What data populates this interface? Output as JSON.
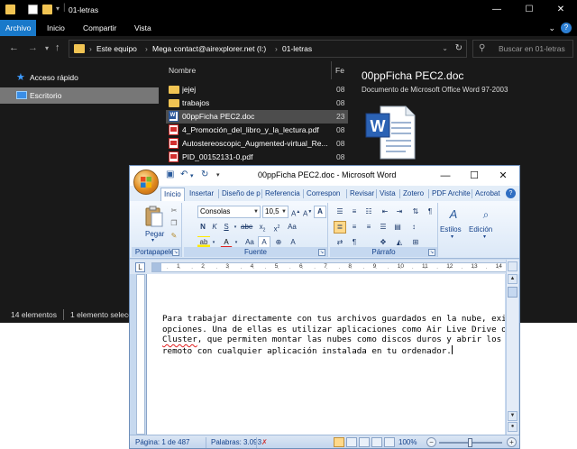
{
  "explorer": {
    "title": "01-letras",
    "ribbon_tabs": [
      "Archivo",
      "Inicio",
      "Compartir",
      "Vista"
    ],
    "breadcrumb": [
      "Este equipo",
      "Mega contact@airexplorer.net (I:)",
      "01-letras"
    ],
    "search_placeholder": "Buscar en 01-letras",
    "nav_items": [
      "Acceso rápido",
      "Escritorio"
    ],
    "columns": {
      "name": "Nombre",
      "date": "Fe"
    },
    "files": [
      {
        "name": "jejej",
        "date": "08",
        "type": "folder"
      },
      {
        "name": "trabajos",
        "date": "08",
        "type": "folder"
      },
      {
        "name": "00ppFicha PEC2.doc",
        "date": "23",
        "type": "doc",
        "selected": true
      },
      {
        "name": "4_Promoción_del_libro_y_la_lectura.pdf",
        "date": "08",
        "type": "pdf"
      },
      {
        "name": "Autostereoscopic_Augmented-virtual_Re...",
        "date": "08",
        "type": "pdf"
      },
      {
        "name": "PID_00152131-0.pdf",
        "date": "08",
        "type": "pdf"
      }
    ],
    "preview": {
      "title": "00ppFicha PEC2.doc",
      "subtitle": "Documento de Microsoft Office Word 97-2003"
    },
    "status": {
      "count": "14 elementos",
      "selection": "1 elemento selecc"
    }
  },
  "word": {
    "title": "00ppFicha PEC2.doc - Microsoft Word",
    "tabs": [
      "Inicio",
      "Insertar",
      "Diseño de p",
      "Referencia",
      "Correspon",
      "Revisar",
      "Vista",
      "Zotero",
      "PDF Archite",
      "Acrobat"
    ],
    "font_name": "Consolas",
    "font_size": "10,5",
    "groups": {
      "clipboard": "Portapapeles",
      "font": "Fuente",
      "paragraph": "Párrafo"
    },
    "paste_label": "Pegar",
    "styles_label": "Estilos",
    "editing_label": "Edición",
    "ruler_numbers": [
      "1",
      "2",
      "3",
      "4",
      "5",
      "6",
      "7",
      "8",
      "9",
      "10",
      "11",
      "12",
      "13",
      "14"
    ],
    "body_lines": [
      "Para trabajar directamente con tus archivos guardados en la nube, exis",
      "opciones. Una de ellas es utilizar aplicaciones como Air Live Drive o",
      ", que permiten montar las nubes como discos duros y abrir los a",
      "remoto con cualquier aplicación instalada en tu ordenador."
    ],
    "misspelled_word": "Cluster",
    "status": {
      "page": "Página: 1 de 487",
      "words": "Palabras: 3.093",
      "zoom": "100%"
    },
    "zoom_percent": 100
  }
}
